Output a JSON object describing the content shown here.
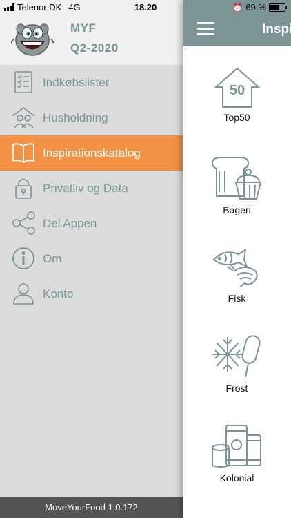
{
  "status": {
    "carrier": "Telenor DK",
    "network": "4G",
    "time": "18.20",
    "battery": "69 %",
    "battery_level": 0.69
  },
  "sidebar": {
    "title": "MYF",
    "subtitle": "Q2-2020",
    "items": [
      {
        "label": "Indkøbslister",
        "icon": "checklist-icon"
      },
      {
        "label": "Husholdning",
        "icon": "household-icon"
      },
      {
        "label": "Inspirationskatalog",
        "icon": "book-icon"
      },
      {
        "label": "Privatliv og Data",
        "icon": "lock-icon"
      },
      {
        "label": "Del Appen",
        "icon": "share-icon"
      },
      {
        "label": "Om",
        "icon": "info-icon"
      },
      {
        "label": "Konto",
        "icon": "user-icon"
      }
    ],
    "footer": "MoveYourFood 1.0.172"
  },
  "main": {
    "title": "Inspirationskatalog",
    "categories": [
      {
        "label": "Top50",
        "icon": "top50-icon",
        "badge": "50"
      },
      {
        "label": "Bageri",
        "icon": "bakery-icon"
      },
      {
        "label": "Fisk",
        "icon": "fish-icon"
      },
      {
        "label": "Frost",
        "icon": "frost-icon"
      },
      {
        "label": "Kolonial",
        "icon": "canned-goods-icon"
      }
    ]
  },
  "colors": {
    "accent": "#f39244",
    "teal": "#7c9496",
    "sidebar_bg": "#dcdcdc"
  }
}
